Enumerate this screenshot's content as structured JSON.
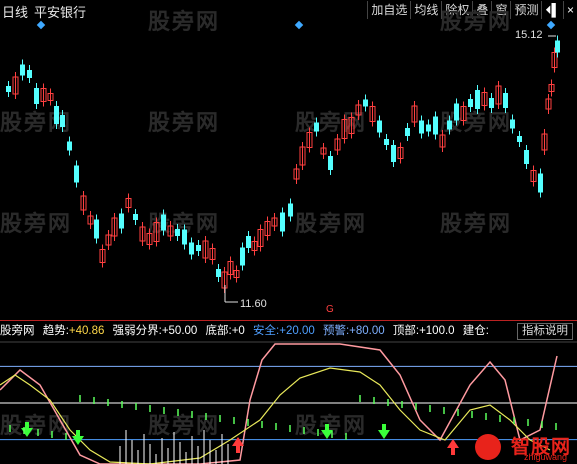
{
  "window": {
    "period": "日线",
    "stock_name": "平安银行"
  },
  "toolbar": {
    "items": [
      "加自选",
      "均线",
      "除权",
      "叠",
      "窗",
      "预测"
    ],
    "arrow_icon": "⏴▌",
    "close_icon": "×"
  },
  "watermark": "股旁网",
  "price_chart": {
    "high_label": "15.12",
    "low_label": "11.60",
    "event_marker": "G",
    "up_color": "#ff4040",
    "down_color": "#54ffff"
  },
  "indicator": {
    "name": "股旁网",
    "values": [
      {
        "label": "趋势:",
        "value": "+40.86",
        "color": "#ffffff",
        "value_color": "#ffd84a"
      },
      {
        "label": "强弱分界:",
        "value": "+50.00",
        "color": "#ffffff",
        "value_color": "#ffffff"
      },
      {
        "label": "底部:",
        "value": "+0",
        "color": "#ffffff",
        "value_color": "#ffffff"
      },
      {
        "label": "安全:",
        "value": "+20.00",
        "color": "#4f9fff",
        "value_color": "#4f9fff"
      },
      {
        "label": "预警:",
        "value": "+80.00",
        "color": "#7fb0ff",
        "value_color": "#7fb0ff"
      },
      {
        "label": "顶部:",
        "value": "+100.0",
        "color": "#ffffff",
        "value_color": "#ffffff"
      },
      {
        "label": "建仓:",
        "value": "",
        "color": "#ffffff",
        "value_color": "#ffffff"
      }
    ],
    "explain_button": "指标说明"
  },
  "logo": {
    "main": "智股网",
    "sub": "zhiguwang"
  }
}
